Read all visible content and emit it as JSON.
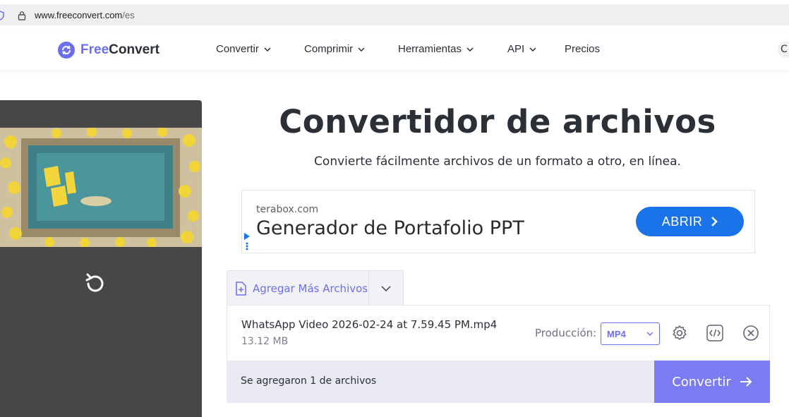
{
  "browser": {
    "url_domain": "www.freeconvert.com",
    "url_path": "/es"
  },
  "header": {
    "logo_free": "Free",
    "logo_convert": "Convert",
    "nav": [
      {
        "label": "Convertir",
        "dropdown": true
      },
      {
        "label": "Comprimir",
        "dropdown": true
      },
      {
        "label": "Herramientas",
        "dropdown": true
      },
      {
        "label": "API",
        "dropdown": true
      },
      {
        "label": "Precios",
        "dropdown": false
      }
    ],
    "edge_glyph": "C"
  },
  "hero": {
    "title": "Convertidor de archivos",
    "subtitle": "Convierte fácilmente archivos de un formato a otro, en línea."
  },
  "ad": {
    "domain": "terabox.com",
    "headline": "Generador de Portafolio PPT",
    "cta": "ABRIR"
  },
  "uploader": {
    "add_more": "Agregar Más Archivos",
    "file": {
      "name": "WhatsApp Video 2026-02-24 at 7.59.45 PM.mp4",
      "size": "13.12 MB",
      "output_label": "Producción:",
      "output_format": "MP4"
    },
    "files_added": "Se agregaron 1 de archivos",
    "convert_label": "Convertir"
  },
  "colors": {
    "brand": "#6c6ef0",
    "ad_button": "#1a73e8",
    "convert_button": "#7b7cf3",
    "preview_bg": "#474747"
  }
}
